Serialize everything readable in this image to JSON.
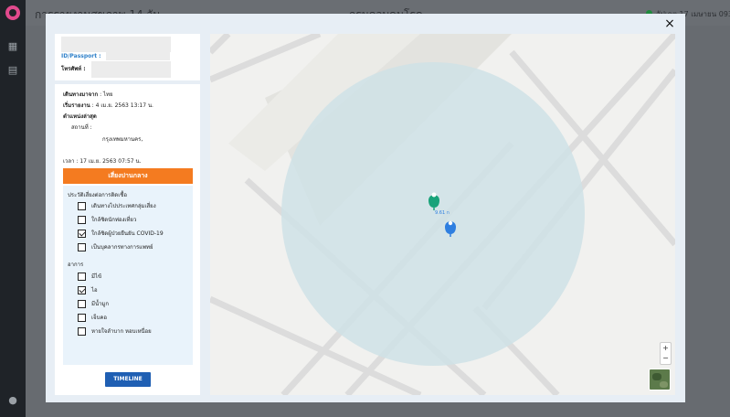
{
  "app": {
    "title": "การรายงานสุขภาพ 14 วัน",
    "center_title": "กรมควบคุมโรค",
    "status_text": "อัปเดต 17 เมษายน 0939",
    "logo_icon": "logo-icon"
  },
  "modal": {
    "close_label": "×",
    "person": {
      "id_label": "ID/Passport :",
      "phone_label": "โทรศัพท์ :"
    },
    "travel": {
      "from_label": "เดินทางมาจาก",
      "from_value": ": ไทย",
      "start_label": "เริ่มรายงาน",
      "start_value": ": 4 เม.ย. 2563 13:17 น.",
      "last_location_label": "ตำแหน่งล่าสุด",
      "place_label": "สถานที่ :",
      "place_value": "กรุงเทพมหานคร,",
      "time_label": "เวลา",
      "time_value": ": 17 เม.ย. 2563 07:57 น."
    },
    "risk_banner": "เสี่ยงปานกลาง",
    "risk_history": {
      "heading": "ประวัติเสี่ยงต่อการติดเชื้อ",
      "items": [
        {
          "label": "เดินทางไปประเทศกลุ่มเสี่ยง",
          "checked": false
        },
        {
          "label": "ใกล้ชิดนักท่องเที่ยว",
          "checked": false
        },
        {
          "label": "ใกล้ชิดผู้ป่วยยืนยัน COVID-19",
          "checked": true
        },
        {
          "label": "เป็นบุคลากรทางการแพทย์",
          "checked": false
        }
      ]
    },
    "symptoms": {
      "heading": "อาการ",
      "items": [
        {
          "label": "มีไข้",
          "checked": false
        },
        {
          "label": "ไอ",
          "checked": true
        },
        {
          "label": "มีน้ำมูก",
          "checked": false
        },
        {
          "label": "เจ็บคอ",
          "checked": false
        },
        {
          "label": "หายใจลำบาก หอบเหนื่อย",
          "checked": false
        }
      ]
    },
    "timeline_button": "TIMELINE",
    "map": {
      "pin_label": "9.61 ก",
      "zoom_in": "+",
      "zoom_out": "−",
      "colors": {
        "radius_fill": "#cfe2e6",
        "green_pin": "#1aa37a",
        "blue_pin": "#2f7fe0",
        "road": "#dcdcdc"
      }
    }
  }
}
